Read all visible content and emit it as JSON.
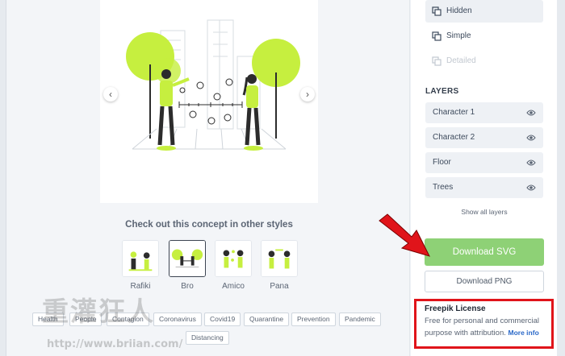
{
  "preview": {
    "prev_icon": "chevron-left-icon",
    "next_icon": "chevron-right-icon",
    "prev_glyph": "‹",
    "next_glyph": "›"
  },
  "concept": {
    "title": "Check out this concept in other styles",
    "styles": [
      {
        "label": "Rafiki",
        "active": false
      },
      {
        "label": "Bro",
        "active": true
      },
      {
        "label": "Amico",
        "active": false
      },
      {
        "label": "Pana",
        "active": false
      }
    ]
  },
  "tags": [
    "Health",
    "People",
    "Contagion",
    "Coronavirus",
    "Covid19",
    "Quarantine",
    "Prevention",
    "Pandemic",
    "Distancing"
  ],
  "watermark": {
    "text": "重灌狂人",
    "url": "http://www.briian.com/"
  },
  "sidebar": {
    "options": [
      {
        "label": "Hidden",
        "icon": "layers-copy-icon",
        "selected": true,
        "disabled": false
      },
      {
        "label": "Simple",
        "icon": "layers-copy-icon",
        "selected": false,
        "disabled": false
      },
      {
        "label": "Detailed",
        "icon": "layers-copy-icon",
        "selected": false,
        "disabled": true
      }
    ],
    "layers_title": "LAYERS",
    "layers": [
      "Character 1",
      "Character 2",
      "Floor",
      "Trees"
    ],
    "eye_icon": "eye-icon",
    "show_all": "Show all layers",
    "download_svg": "Download SVG",
    "download_png": "Download PNG",
    "license_title": "Freepik License",
    "license_text": "Free for personal and commercial purpose with attribution.",
    "license_link": "More info"
  },
  "colors": {
    "accent_green": "#8ed176",
    "illustration_green": "#c6ef3f",
    "highlight_red": "#e0141a",
    "link_blue": "#2a68c8"
  }
}
